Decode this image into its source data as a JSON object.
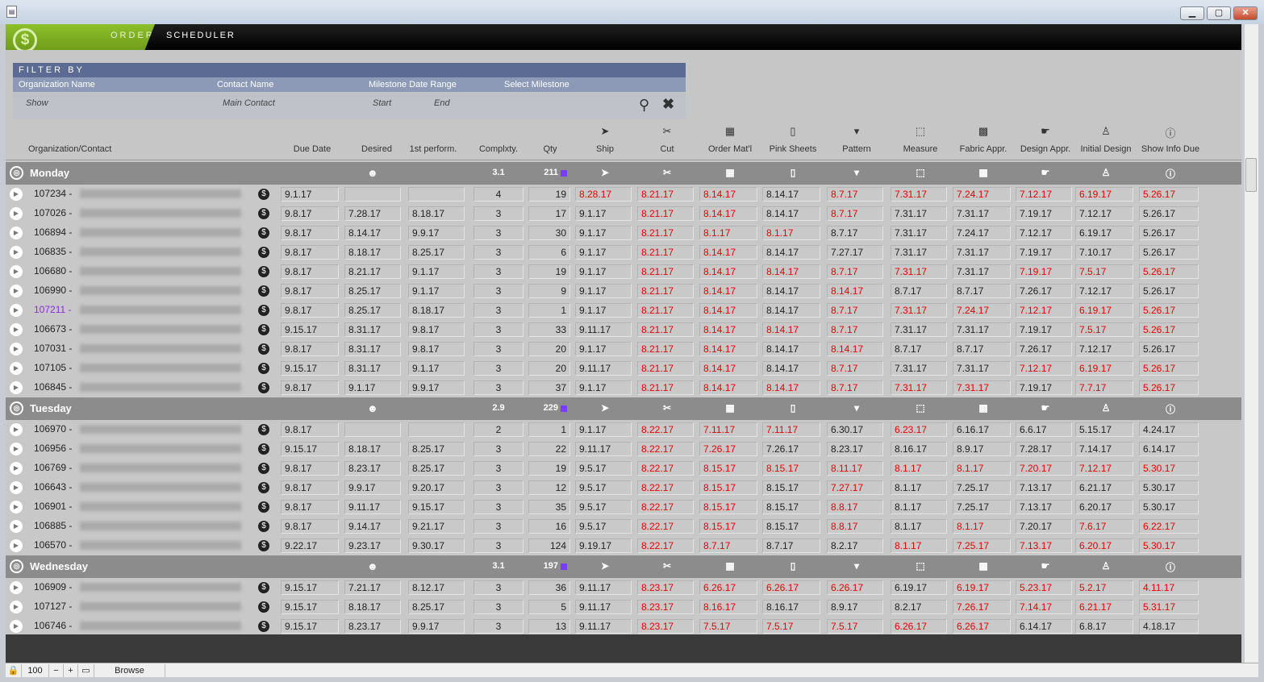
{
  "window": {
    "title_icon": "document-icon",
    "buttons": [
      "▁",
      "▢",
      "✕"
    ]
  },
  "brand": {
    "part1": "ORDER",
    "part2": "SCHEDULER",
    "logo": "$"
  },
  "filter": {
    "header": "FILTER BY",
    "labels": [
      "Organization Name",
      "Contact Name",
      "Milestone Date Range",
      "Select Milestone"
    ],
    "placeholders": [
      "Show",
      "Main Contact",
      "Start",
      "End"
    ]
  },
  "columns": {
    "static": [
      "Organization/Contact",
      "Due Date",
      "Desired",
      "1st perform.",
      "Complxty.",
      "Qty"
    ],
    "milestones": [
      "Ship",
      "Cut",
      "Order Mat'l",
      "Pink Sheets",
      "Pattern",
      "Measure",
      "Fabric Appr.",
      "Design Appr.",
      "Initial Design",
      "Show Info Due"
    ],
    "milestone_icons": [
      "➤",
      "✂",
      "▦",
      "▯",
      "▾",
      "⬚",
      "▩",
      "☛",
      "♙",
      "ⓘ"
    ]
  },
  "groups": [
    {
      "name": "Monday",
      "complexity": "3.1",
      "qty": "211",
      "rows": [
        {
          "id": "107234 -",
          "due": "9.1.17",
          "desired": "",
          "first": "",
          "cx": "4",
          "qty": "19",
          "m": [
            "8.28.17",
            "8.21.17",
            "8.14.17",
            "8.14.17",
            "8.7.17",
            "7.31.17",
            "7.24.17",
            "7.12.17",
            "6.19.17",
            "5.26.17"
          ],
          "r": [
            1,
            1,
            1,
            0,
            1,
            1,
            1,
            1,
            1,
            1
          ]
        },
        {
          "id": "107026 -",
          "due": "9.8.17",
          "desired": "7.28.17",
          "first": "8.18.17",
          "cx": "3",
          "qty": "17",
          "m": [
            "9.1.17",
            "8.21.17",
            "8.14.17",
            "8.14.17",
            "8.7.17",
            "7.31.17",
            "7.31.17",
            "7.19.17",
            "7.12.17",
            "5.26.17"
          ],
          "r": [
            0,
            1,
            1,
            0,
            1,
            0,
            0,
            0,
            0,
            0
          ]
        },
        {
          "id": "106894 -",
          "due": "9.8.17",
          "desired": "8.14.17",
          "first": "9.9.17",
          "cx": "3",
          "qty": "30",
          "m": [
            "9.1.17",
            "8.21.17",
            "8.1.17",
            "8.1.17",
            "8.7.17",
            "7.31.17",
            "7.24.17",
            "7.12.17",
            "6.19.17",
            "5.26.17"
          ],
          "r": [
            0,
            1,
            1,
            1,
            0,
            0,
            0,
            0,
            0,
            0
          ]
        },
        {
          "id": "106835 -",
          "due": "9.8.17",
          "desired": "8.18.17",
          "first": "8.25.17",
          "cx": "3",
          "qty": "6",
          "m": [
            "9.1.17",
            "8.21.17",
            "8.14.17",
            "8.14.17",
            "7.27.17",
            "7.31.17",
            "7.31.17",
            "7.19.17",
            "7.10.17",
            "5.26.17"
          ],
          "r": [
            0,
            1,
            1,
            0,
            0,
            0,
            0,
            0,
            0,
            0
          ]
        },
        {
          "id": "106680 -",
          "due": "9.8.17",
          "desired": "8.21.17",
          "first": "9.1.17",
          "cx": "3",
          "qty": "19",
          "m": [
            "9.1.17",
            "8.21.17",
            "8.14.17",
            "8.14.17",
            "8.7.17",
            "7.31.17",
            "7.31.17",
            "7.19.17",
            "7.5.17",
            "5.26.17"
          ],
          "r": [
            0,
            1,
            1,
            1,
            1,
            1,
            0,
            1,
            1,
            1
          ]
        },
        {
          "id": "106990 -",
          "due": "9.8.17",
          "desired": "8.25.17",
          "first": "9.1.17",
          "cx": "3",
          "qty": "9",
          "m": [
            "9.1.17",
            "8.21.17",
            "8.14.17",
            "8.14.17",
            "8.14.17",
            "8.7.17",
            "8.7.17",
            "7.26.17",
            "7.12.17",
            "5.26.17"
          ],
          "r": [
            0,
            1,
            1,
            0,
            1,
            0,
            0,
            0,
            0,
            0
          ]
        },
        {
          "id": "107211 -",
          "due": "9.8.17",
          "desired": "8.25.17",
          "first": "8.18.17",
          "cx": "3",
          "qty": "1",
          "m": [
            "9.1.17",
            "8.21.17",
            "8.14.17",
            "8.14.17",
            "8.7.17",
            "7.31.17",
            "7.24.17",
            "7.12.17",
            "6.19.17",
            "5.26.17"
          ],
          "r": [
            0,
            1,
            1,
            0,
            1,
            1,
            1,
            1,
            1,
            1
          ],
          "purple": true
        },
        {
          "id": "106673 -",
          "due": "9.15.17",
          "desired": "8.31.17",
          "first": "9.8.17",
          "cx": "3",
          "qty": "33",
          "m": [
            "9.11.17",
            "8.21.17",
            "8.14.17",
            "8.14.17",
            "8.7.17",
            "7.31.17",
            "7.31.17",
            "7.19.17",
            "7.5.17",
            "5.26.17"
          ],
          "r": [
            0,
            1,
            1,
            1,
            1,
            0,
            0,
            0,
            1,
            1
          ]
        },
        {
          "id": "107031 -",
          "due": "9.8.17",
          "desired": "8.31.17",
          "first": "9.8.17",
          "cx": "3",
          "qty": "20",
          "m": [
            "9.1.17",
            "8.21.17",
            "8.14.17",
            "8.14.17",
            "8.14.17",
            "8.7.17",
            "8.7.17",
            "7.26.17",
            "7.12.17",
            "5.26.17"
          ],
          "r": [
            0,
            1,
            1,
            0,
            1,
            0,
            0,
            0,
            0,
            0
          ]
        },
        {
          "id": "107105 -",
          "due": "9.15.17",
          "desired": "8.31.17",
          "first": "9.1.17",
          "cx": "3",
          "qty": "20",
          "m": [
            "9.11.17",
            "8.21.17",
            "8.14.17",
            "8.14.17",
            "8.7.17",
            "7.31.17",
            "7.31.17",
            "7.12.17",
            "6.19.17",
            "5.26.17"
          ],
          "r": [
            0,
            1,
            1,
            0,
            1,
            0,
            0,
            1,
            1,
            1
          ]
        },
        {
          "id": "106845 -",
          "due": "9.8.17",
          "desired": "9.1.17",
          "first": "9.9.17",
          "cx": "3",
          "qty": "37",
          "m": [
            "9.1.17",
            "8.21.17",
            "8.14.17",
            "8.14.17",
            "8.7.17",
            "7.31.17",
            "7.31.17",
            "7.19.17",
            "7.7.17",
            "5.26.17"
          ],
          "r": [
            0,
            1,
            1,
            1,
            1,
            1,
            1,
            0,
            1,
            1
          ]
        }
      ]
    },
    {
      "name": "Tuesday",
      "complexity": "2.9",
      "qty": "229",
      "rows": [
        {
          "id": "106970 -",
          "due": "9.8.17",
          "desired": "",
          "first": "",
          "cx": "2",
          "qty": "1",
          "m": [
            "9.1.17",
            "8.22.17",
            "7.11.17",
            "7.11.17",
            "6.30.17",
            "6.23.17",
            "6.16.17",
            "6.6.17",
            "5.15.17",
            "4.24.17"
          ],
          "r": [
            0,
            1,
            1,
            1,
            0,
            1,
            0,
            0,
            0,
            0
          ]
        },
        {
          "id": "106956 -",
          "due": "9.15.17",
          "desired": "8.18.17",
          "first": "8.25.17",
          "cx": "3",
          "qty": "22",
          "m": [
            "9.11.17",
            "8.22.17",
            "7.26.17",
            "7.26.17",
            "8.23.17",
            "8.16.17",
            "8.9.17",
            "7.28.17",
            "7.14.17",
            "6.14.17"
          ],
          "r": [
            0,
            1,
            1,
            0,
            0,
            0,
            0,
            0,
            0,
            0
          ]
        },
        {
          "id": "106769 -",
          "due": "9.8.17",
          "desired": "8.23.17",
          "first": "8.25.17",
          "cx": "3",
          "qty": "19",
          "m": [
            "9.5.17",
            "8.22.17",
            "8.15.17",
            "8.15.17",
            "8.11.17",
            "8.1.17",
            "8.1.17",
            "7.20.17",
            "7.12.17",
            "5.30.17"
          ],
          "r": [
            0,
            1,
            1,
            1,
            1,
            1,
            1,
            1,
            1,
            1
          ]
        },
        {
          "id": "106643 -",
          "due": "9.8.17",
          "desired": "9.9.17",
          "first": "9.20.17",
          "cx": "3",
          "qty": "12",
          "m": [
            "9.5.17",
            "8.22.17",
            "8.15.17",
            "8.15.17",
            "7.27.17",
            "8.1.17",
            "7.25.17",
            "7.13.17",
            "6.21.17",
            "5.30.17"
          ],
          "r": [
            0,
            1,
            1,
            0,
            1,
            0,
            0,
            0,
            0,
            0
          ]
        },
        {
          "id": "106901 -",
          "due": "9.8.17",
          "desired": "9.11.17",
          "first": "9.15.17",
          "cx": "3",
          "qty": "35",
          "m": [
            "9.5.17",
            "8.22.17",
            "8.15.17",
            "8.15.17",
            "8.8.17",
            "8.1.17",
            "7.25.17",
            "7.13.17",
            "6.20.17",
            "5.30.17"
          ],
          "r": [
            0,
            1,
            1,
            0,
            1,
            0,
            0,
            0,
            0,
            0
          ]
        },
        {
          "id": "106885 -",
          "due": "9.8.17",
          "desired": "9.14.17",
          "first": "9.21.17",
          "cx": "3",
          "qty": "16",
          "m": [
            "9.5.17",
            "8.22.17",
            "8.15.17",
            "8.15.17",
            "8.8.17",
            "8.1.17",
            "8.1.17",
            "7.20.17",
            "7.6.17",
            "6.22.17"
          ],
          "r": [
            0,
            1,
            1,
            0,
            1,
            0,
            1,
            0,
            1,
            1
          ]
        },
        {
          "id": "106570 -",
          "due": "9.22.17",
          "desired": "9.23.17",
          "first": "9.30.17",
          "cx": "3",
          "qty": "124",
          "m": [
            "9.19.17",
            "8.22.17",
            "8.7.17",
            "8.7.17",
            "8.2.17",
            "8.1.17",
            "7.25.17",
            "7.13.17",
            "6.20.17",
            "5.30.17"
          ],
          "r": [
            0,
            1,
            1,
            0,
            0,
            1,
            1,
            1,
            1,
            1
          ]
        }
      ]
    },
    {
      "name": "Wednesday",
      "complexity": "3.1",
      "qty": "197",
      "rows": [
        {
          "id": "106909 -",
          "due": "9.15.17",
          "desired": "7.21.17",
          "first": "8.12.17",
          "cx": "3",
          "qty": "36",
          "m": [
            "9.11.17",
            "8.23.17",
            "6.26.17",
            "6.26.17",
            "6.26.17",
            "6.19.17",
            "6.19.17",
            "5.23.17",
            "5.2.17",
            "4.11.17"
          ],
          "r": [
            0,
            1,
            1,
            1,
            1,
            0,
            1,
            1,
            1,
            1
          ]
        },
        {
          "id": "107127 -",
          "due": "9.15.17",
          "desired": "8.18.17",
          "first": "8.25.17",
          "cx": "3",
          "qty": "5",
          "m": [
            "9.11.17",
            "8.23.17",
            "8.16.17",
            "8.16.17",
            "8.9.17",
            "8.2.17",
            "7.26.17",
            "7.14.17",
            "6.21.17",
            "5.31.17"
          ],
          "r": [
            0,
            1,
            1,
            0,
            0,
            0,
            1,
            1,
            1,
            1
          ]
        },
        {
          "id": "106746 -",
          "due": "9.15.17",
          "desired": "8.23.17",
          "first": "9.9.17",
          "cx": "3",
          "qty": "13",
          "m": [
            "9.11.17",
            "8.23.17",
            "7.5.17",
            "7.5.17",
            "7.5.17",
            "6.26.17",
            "6.26.17",
            "6.14.17",
            "6.8.17",
            "4.18.17"
          ],
          "r": [
            0,
            1,
            1,
            1,
            1,
            1,
            1,
            0,
            0,
            0
          ]
        }
      ]
    }
  ],
  "statusbar": {
    "zoom": "100",
    "mode": "Browse"
  }
}
